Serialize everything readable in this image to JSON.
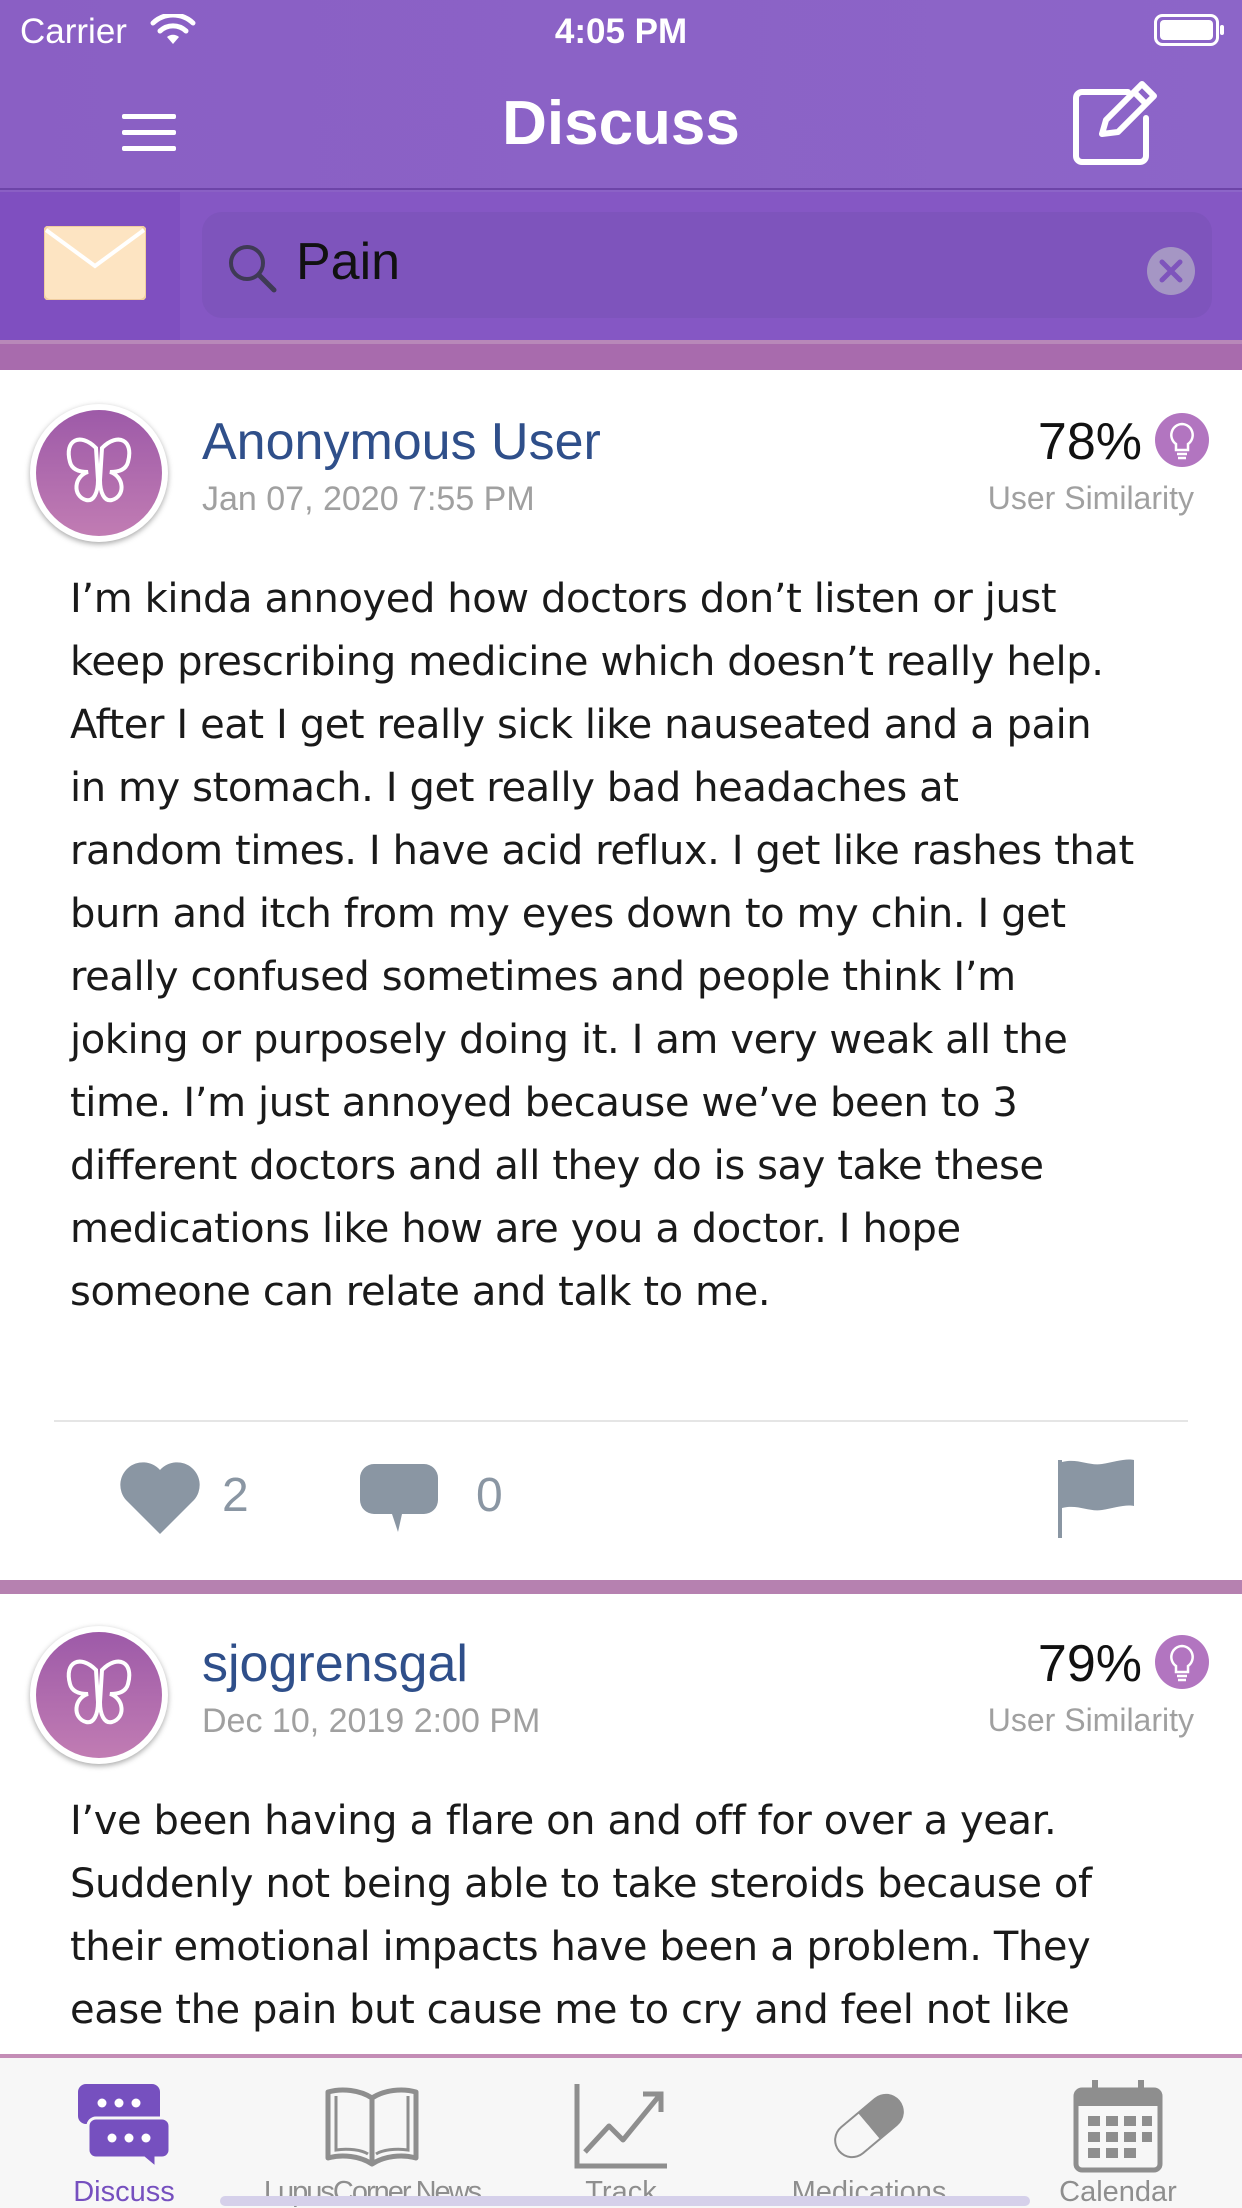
{
  "status_bar": {
    "carrier": "Carrier",
    "time": "4:05 PM"
  },
  "nav": {
    "title": "Discuss"
  },
  "search": {
    "value": "Pain"
  },
  "colors": {
    "header_purple": "#8a5fc4",
    "accent_pink": "#b681b0",
    "author_blue": "#2f4f8a",
    "active_tab": "#7650bf"
  },
  "posts": [
    {
      "author": "Anonymous User",
      "date": "Jan 07, 2020 7:55 PM",
      "similarity": "78%",
      "similarity_label": "User Similarity",
      "body_lines": [
        "I’m kinda annoyed how doctors don’t listen or just",
        "keep prescribing medicine which doesn’t really help.",
        "After I eat I get really sick like nauseated and a pain",
        "in my stomach. I get really bad headaches at",
        "random times. I have acid reflux. I get like rashes that",
        "burn and itch from my eyes down to my chin. I get",
        "really confused sometimes and people think I’m",
        "joking or purposely doing it. I am very weak all the",
        "time. I’m just annoyed because we’ve been to 3",
        "different doctors and all they do is say take these",
        "medications like how are you a doctor. I hope",
        "someone can relate and talk to me."
      ],
      "likes": "2",
      "comments": "0"
    },
    {
      "author": "sjogrensgal",
      "date": "Dec 10, 2019 2:00 PM",
      "similarity": "79%",
      "similarity_label": "User Similarity",
      "body_lines": [
        "I’ve been having a flare on and off for over a year.",
        "Suddenly not being able to take steroids because of",
        "their emotional impacts have been a problem.  They",
        "ease the pain but cause me to cry and feel not like"
      ]
    }
  ],
  "tabs": [
    {
      "label": "Discuss",
      "icon": "chat-bubbles-icon",
      "active": true
    },
    {
      "label": "LupusCorner News",
      "icon": "open-book-icon",
      "active": false
    },
    {
      "label": "Track",
      "icon": "trend-chart-icon",
      "active": false
    },
    {
      "label": "Medications",
      "icon": "pill-icon",
      "active": false
    },
    {
      "label": "Calendar",
      "icon": "calendar-icon",
      "active": false
    }
  ]
}
